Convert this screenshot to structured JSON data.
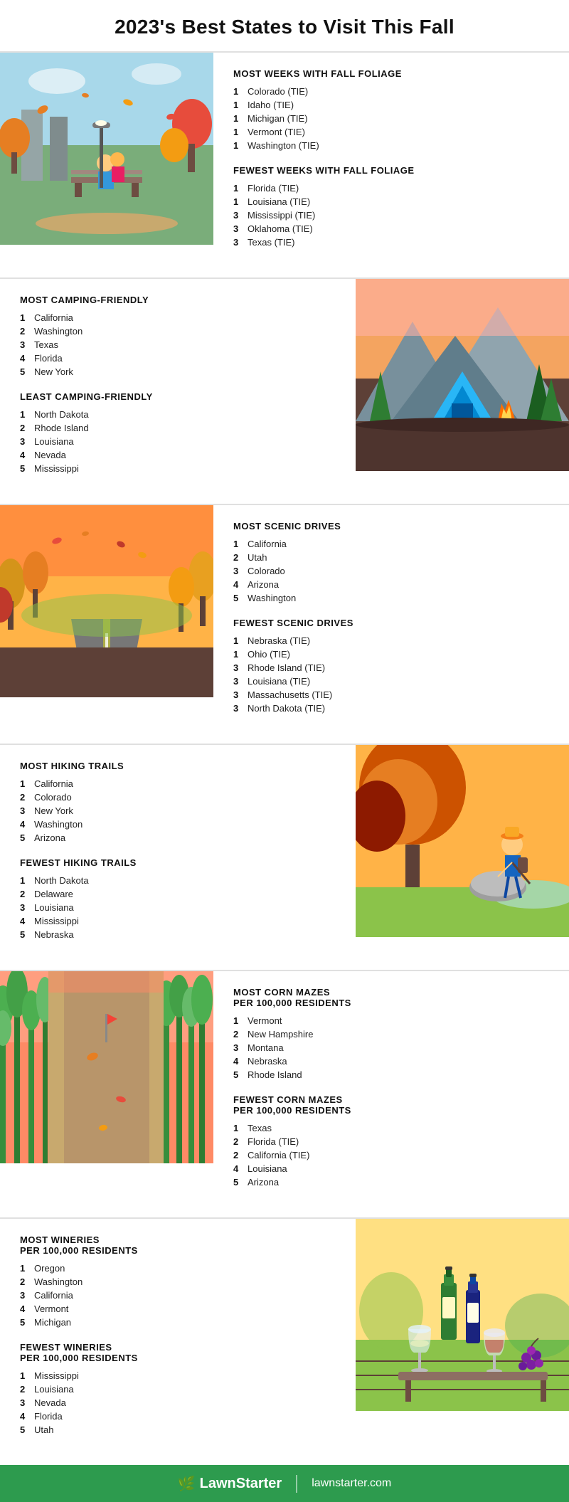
{
  "title": "2023's Best States to Visit This Fall",
  "sections": [
    {
      "id": "foliage",
      "layout": "right-content",
      "image_type": "fall-couple",
      "lists": [
        {
          "title": "MOST WEEKS WITH FALL FOLIAGE",
          "items": [
            {
              "num": "1",
              "text": "Colorado (TIE)"
            },
            {
              "num": "1",
              "text": "Idaho (TIE)"
            },
            {
              "num": "1",
              "text": "Michigan (TIE)"
            },
            {
              "num": "1",
              "text": "Vermont (TIE)"
            },
            {
              "num": "1",
              "text": "Washington (TIE)"
            }
          ]
        },
        {
          "title": "FEWEST WEEKS WITH FALL FOLIAGE",
          "items": [
            {
              "num": "1",
              "text": "Florida (TIE)"
            },
            {
              "num": "1",
              "text": "Louisiana (TIE)"
            },
            {
              "num": "3",
              "text": "Mississippi (TIE)"
            },
            {
              "num": "3",
              "text": "Oklahoma (TIE)"
            },
            {
              "num": "3",
              "text": "Texas (TIE)"
            }
          ]
        }
      ]
    },
    {
      "id": "camping",
      "layout": "left-content",
      "image_type": "camping",
      "lists": [
        {
          "title": "MOST CAMPING-FRIENDLY",
          "items": [
            {
              "num": "1",
              "text": "California"
            },
            {
              "num": "2",
              "text": "Washington"
            },
            {
              "num": "3",
              "text": "Texas"
            },
            {
              "num": "4",
              "text": "Florida"
            },
            {
              "num": "5",
              "text": "New York"
            }
          ]
        },
        {
          "title": "LEAST CAMPING-FRIENDLY",
          "items": [
            {
              "num": "1",
              "text": "North Dakota"
            },
            {
              "num": "2",
              "text": "Rhode Island"
            },
            {
              "num": "3",
              "text": "Louisiana"
            },
            {
              "num": "4",
              "text": "Nevada"
            },
            {
              "num": "5",
              "text": "Mississippi"
            }
          ]
        }
      ]
    },
    {
      "id": "scenic",
      "layout": "right-content",
      "image_type": "scenic-drive",
      "lists": [
        {
          "title": "MOST SCENIC DRIVES",
          "items": [
            {
              "num": "1",
              "text": "California"
            },
            {
              "num": "2",
              "text": "Utah"
            },
            {
              "num": "3",
              "text": "Colorado"
            },
            {
              "num": "4",
              "text": "Arizona"
            },
            {
              "num": "5",
              "text": "Washington"
            }
          ]
        },
        {
          "title": "FEWEST SCENIC DRIVES",
          "items": [
            {
              "num": "1",
              "text": "Nebraska (TIE)"
            },
            {
              "num": "1",
              "text": "Ohio (TIE)"
            },
            {
              "num": "3",
              "text": "Rhode Island (TIE)"
            },
            {
              "num": "3",
              "text": "Louisiana (TIE)"
            },
            {
              "num": "3",
              "text": "Massachusetts (TIE)"
            },
            {
              "num": "3",
              "text": "North Dakota (TIE)"
            }
          ]
        }
      ]
    },
    {
      "id": "hiking",
      "layout": "left-content",
      "image_type": "hiking",
      "lists": [
        {
          "title": "MOST HIKING TRAILS",
          "items": [
            {
              "num": "1",
              "text": "California"
            },
            {
              "num": "2",
              "text": "Colorado"
            },
            {
              "num": "3",
              "text": "New York"
            },
            {
              "num": "4",
              "text": "Washington"
            },
            {
              "num": "5",
              "text": "Arizona"
            }
          ]
        },
        {
          "title": "FEWEST HIKING TRAILS",
          "items": [
            {
              "num": "1",
              "text": "North Dakota"
            },
            {
              "num": "2",
              "text": "Delaware"
            },
            {
              "num": "3",
              "text": "Louisiana"
            },
            {
              "num": "4",
              "text": "Mississippi"
            },
            {
              "num": "5",
              "text": "Nebraska"
            }
          ]
        }
      ]
    },
    {
      "id": "corn-maze",
      "layout": "right-content",
      "image_type": "corn-maze",
      "lists": [
        {
          "title": "MOST CORN MAZES\nPER 100,000 RESIDENTS",
          "items": [
            {
              "num": "1",
              "text": "Vermont"
            },
            {
              "num": "2",
              "text": "New Hampshire"
            },
            {
              "num": "3",
              "text": "Montana"
            },
            {
              "num": "4",
              "text": "Nebraska"
            },
            {
              "num": "5",
              "text": "Rhode Island"
            }
          ]
        },
        {
          "title": "FEWEST CORN MAZES\nPER 100,000 RESIDENTS",
          "items": [
            {
              "num": "1",
              "text": "Texas"
            },
            {
              "num": "2",
              "text": "Florida (TIE)"
            },
            {
              "num": "2",
              "text": "California (TIE)"
            },
            {
              "num": "4",
              "text": "Louisiana"
            },
            {
              "num": "5",
              "text": "Arizona"
            }
          ]
        }
      ]
    },
    {
      "id": "winery",
      "layout": "left-content",
      "image_type": "winery",
      "lists": [
        {
          "title": "MOST WINERIES\nPER 100,000 RESIDENTS",
          "items": [
            {
              "num": "1",
              "text": "Oregon"
            },
            {
              "num": "2",
              "text": "Washington"
            },
            {
              "num": "3",
              "text": "California"
            },
            {
              "num": "4",
              "text": "Vermont"
            },
            {
              "num": "5",
              "text": "Michigan"
            }
          ]
        },
        {
          "title": "FEWEST WINERIES\nPER 100,000 RESIDENTS",
          "items": [
            {
              "num": "1",
              "text": "Mississippi"
            },
            {
              "num": "2",
              "text": "Louisiana"
            },
            {
              "num": "3",
              "text": "Nevada"
            },
            {
              "num": "4",
              "text": "Florida"
            },
            {
              "num": "5",
              "text": "Utah"
            }
          ]
        }
      ]
    }
  ],
  "footer": {
    "brand": "LawnStarter",
    "url": "lawnstarter.com"
  }
}
